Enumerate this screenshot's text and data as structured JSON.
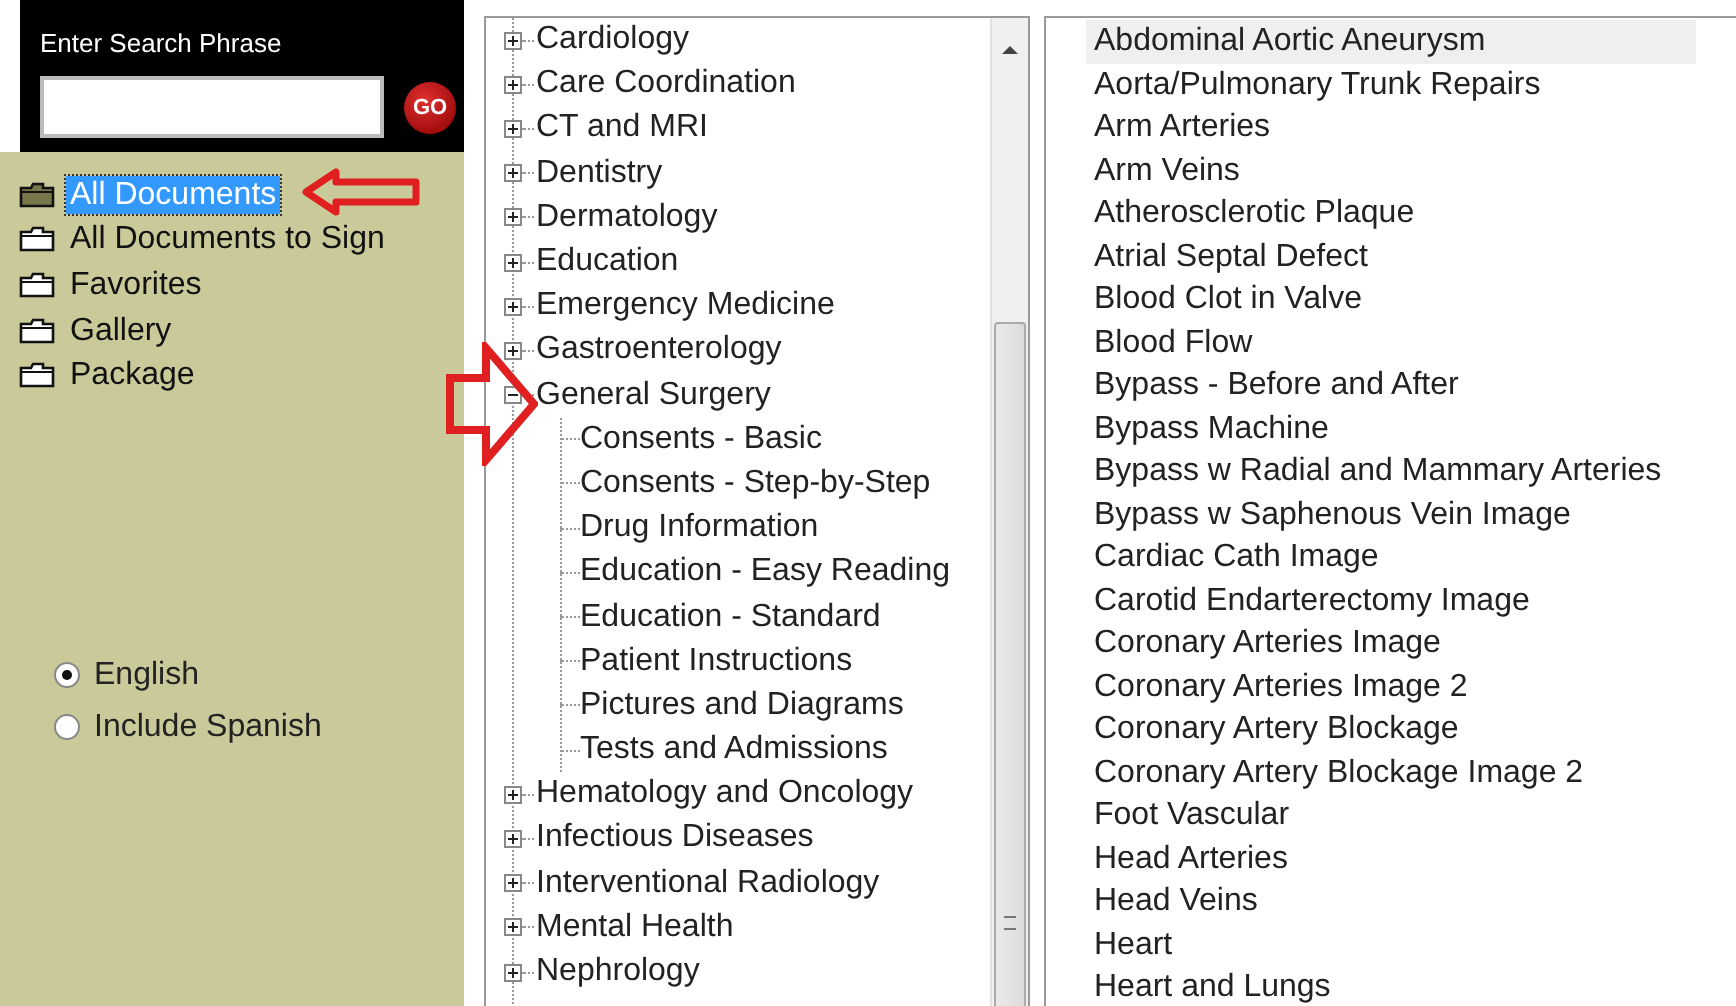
{
  "search": {
    "label": "Enter Search Phrase",
    "button": "GO"
  },
  "folders": [
    {
      "label": "All Documents",
      "selected": true
    },
    {
      "label": "All Documents to Sign",
      "selected": false
    },
    {
      "label": "Favorites",
      "selected": false
    },
    {
      "label": "Gallery",
      "selected": false
    },
    {
      "label": "Package",
      "selected": false
    }
  ],
  "language": [
    {
      "label": "English",
      "selected": true
    },
    {
      "label": "Include Spanish",
      "selected": false
    }
  ],
  "categories": [
    {
      "label": "Cardiology",
      "expanded": false
    },
    {
      "label": "Care Coordination",
      "expanded": false
    },
    {
      "label": "CT and MRI",
      "expanded": false
    },
    {
      "label": "Dentistry",
      "expanded": false
    },
    {
      "label": "Dermatology",
      "expanded": false
    },
    {
      "label": "Education",
      "expanded": false
    },
    {
      "label": "Emergency Medicine",
      "expanded": false
    },
    {
      "label": "Gastroenterology",
      "expanded": false
    },
    {
      "label": "General Surgery",
      "expanded": true,
      "children": [
        {
          "label": "Consents - Basic"
        },
        {
          "label": "Consents - Step-by-Step"
        },
        {
          "label": "Drug Information"
        },
        {
          "label": "Education - Easy Reading"
        },
        {
          "label": "Education - Standard"
        },
        {
          "label": "Patient Instructions"
        },
        {
          "label": "Pictures and Diagrams"
        },
        {
          "label": "Tests and Admissions"
        }
      ]
    },
    {
      "label": "Hematology and Oncology",
      "expanded": false
    },
    {
      "label": "Infectious Diseases",
      "expanded": false
    },
    {
      "label": "Interventional Radiology",
      "expanded": false
    },
    {
      "label": "Mental Health",
      "expanded": false
    },
    {
      "label": "Nephrology",
      "expanded": false
    }
  ],
  "documents": [
    {
      "label": "Abdominal Aortic Aneurysm",
      "selected": true
    },
    {
      "label": "Aorta/Pulmonary Trunk Repairs",
      "selected": false
    },
    {
      "label": "Arm Arteries",
      "selected": false
    },
    {
      "label": "Arm Veins",
      "selected": false
    },
    {
      "label": "Atherosclerotic Plaque",
      "selected": false
    },
    {
      "label": "Atrial Septal Defect",
      "selected": false
    },
    {
      "label": "Blood Clot in Valve",
      "selected": false
    },
    {
      "label": "Blood Flow",
      "selected": false
    },
    {
      "label": "Bypass - Before and After",
      "selected": false
    },
    {
      "label": "Bypass Machine",
      "selected": false
    },
    {
      "label": "Bypass w Radial and Mammary Arteries",
      "selected": false
    },
    {
      "label": "Bypass w Saphenous Vein Image",
      "selected": false
    },
    {
      "label": "Cardiac Cath Image",
      "selected": false
    },
    {
      "label": "Carotid Endarterectomy Image",
      "selected": false
    },
    {
      "label": "Coronary Arteries Image",
      "selected": false
    },
    {
      "label": "Coronary Arteries Image 2",
      "selected": false
    },
    {
      "label": "Coronary Artery Blockage",
      "selected": false
    },
    {
      "label": "Coronary Artery Blockage Image 2",
      "selected": false
    },
    {
      "label": "Foot Vascular",
      "selected": false
    },
    {
      "label": "Head Arteries",
      "selected": false
    },
    {
      "label": "Head Veins",
      "selected": false
    },
    {
      "label": "Heart",
      "selected": false
    },
    {
      "label": "Heart and Lungs",
      "selected": false
    }
  ]
}
